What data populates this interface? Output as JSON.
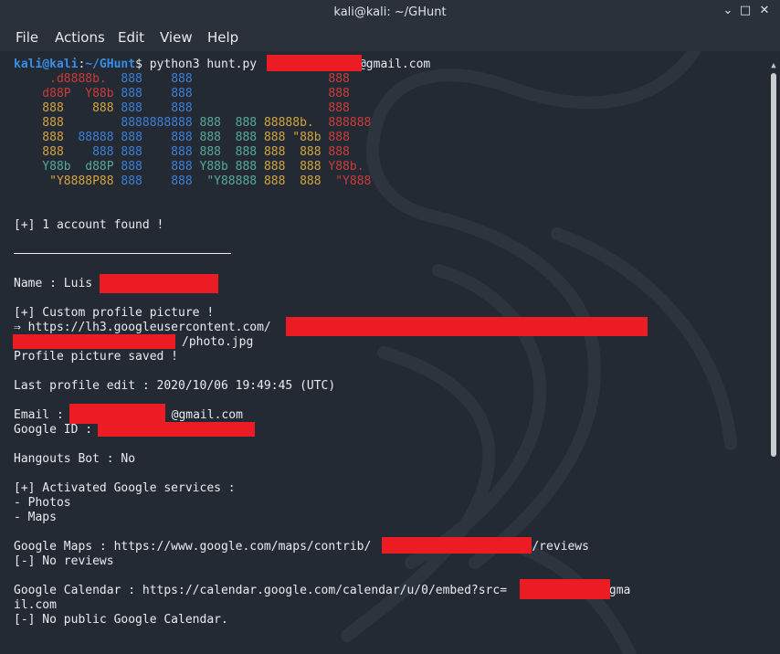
{
  "window": {
    "title": "kali@kali: ~/GHunt",
    "minimize": "⌄",
    "maximize": "□",
    "close": "✕"
  },
  "menu": [
    "File",
    "Actions",
    "Edit",
    "View",
    "Help"
  ],
  "prompt": {
    "user": "kali@kali",
    "sep": ":",
    "path": "~/GHunt",
    "sign": "$",
    "command": " python3 hunt.py ",
    "email_suffix": "@gmail.com"
  },
  "banner": [
    [
      [
        "red",
        "     .d8888b.  "
      ],
      [
        "blue",
        "888    888"
      ],
      [
        "red",
        "                   888"
      ]
    ],
    [
      [
        "red",
        "    d88P  Y88b "
      ],
      [
        "blue",
        "888    888"
      ],
      [
        "red",
        "                   888"
      ]
    ],
    [
      [
        "yellow",
        "    888    888 "
      ],
      [
        "blue",
        "888    888"
      ],
      [
        "red",
        "                   888"
      ]
    ],
    [
      [
        "yellow",
        "    888        "
      ],
      [
        "blue",
        "8888888888 "
      ],
      [
        "green",
        "888  888 "
      ],
      [
        "yellow",
        "88888b.  "
      ],
      [
        "red",
        "888888"
      ]
    ],
    [
      [
        "yellow",
        "    888  "
      ],
      [
        "blue",
        "88888 888    888 "
      ],
      [
        "green",
        "888  888 "
      ],
      [
        "yellow",
        "888 \"88b "
      ],
      [
        "red",
        "888"
      ]
    ],
    [
      [
        "yellow",
        "    888    "
      ],
      [
        "blue",
        "888 888    888 "
      ],
      [
        "green",
        "888  888 "
      ],
      [
        "yellow",
        "888  888 "
      ],
      [
        "red",
        "888"
      ]
    ],
    [
      [
        "green",
        "    Y88b  d88P "
      ],
      [
        "blue",
        "888    888 "
      ],
      [
        "green",
        "Y88b 888 "
      ],
      [
        "yellow",
        "888  888 "
      ],
      [
        "red",
        "Y88b."
      ]
    ],
    [
      [
        "yellow",
        "     \"Y8888P88 "
      ],
      [
        "blue",
        "888    888  "
      ],
      [
        "green",
        "\"Y88888 "
      ],
      [
        "yellow",
        "888  888  "
      ],
      [
        "red",
        "\"Y888"
      ]
    ]
  ],
  "account_found": "[+] 1 account found !",
  "name_line": "Name : Luis",
  "custom_pic": "[+] Custom profile picture !",
  "pic_url_prefix": "⇒ https://lh3.googleusercontent.com/",
  "pic_url_suffix": "/photo.jpg",
  "pic_saved": "Profile picture saved !",
  "last_edit": "Last profile edit : 2020/10/06 19:49:45 (UTC)",
  "email_label": "Email : ",
  "email_suffix": "@gmail.com",
  "gid_label": "Google ID : ",
  "hangouts": "Hangouts Bot : No",
  "services_title": "[+] Activated Google services :",
  "services": [
    "- Photos",
    "- Maps"
  ],
  "maps_prefix": "Google Maps : https://www.google.com/maps/contrib/",
  "maps_suffix": "/reviews",
  "no_reviews": "[-] No reviews",
  "cal_prefix": "Google Calendar : https://calendar.google.com/calendar/u/0/embed?src=",
  "cal_suffix": "@gma",
  "cal_wrap": "il.com",
  "no_calendar": "[-] No public Google Calendar."
}
